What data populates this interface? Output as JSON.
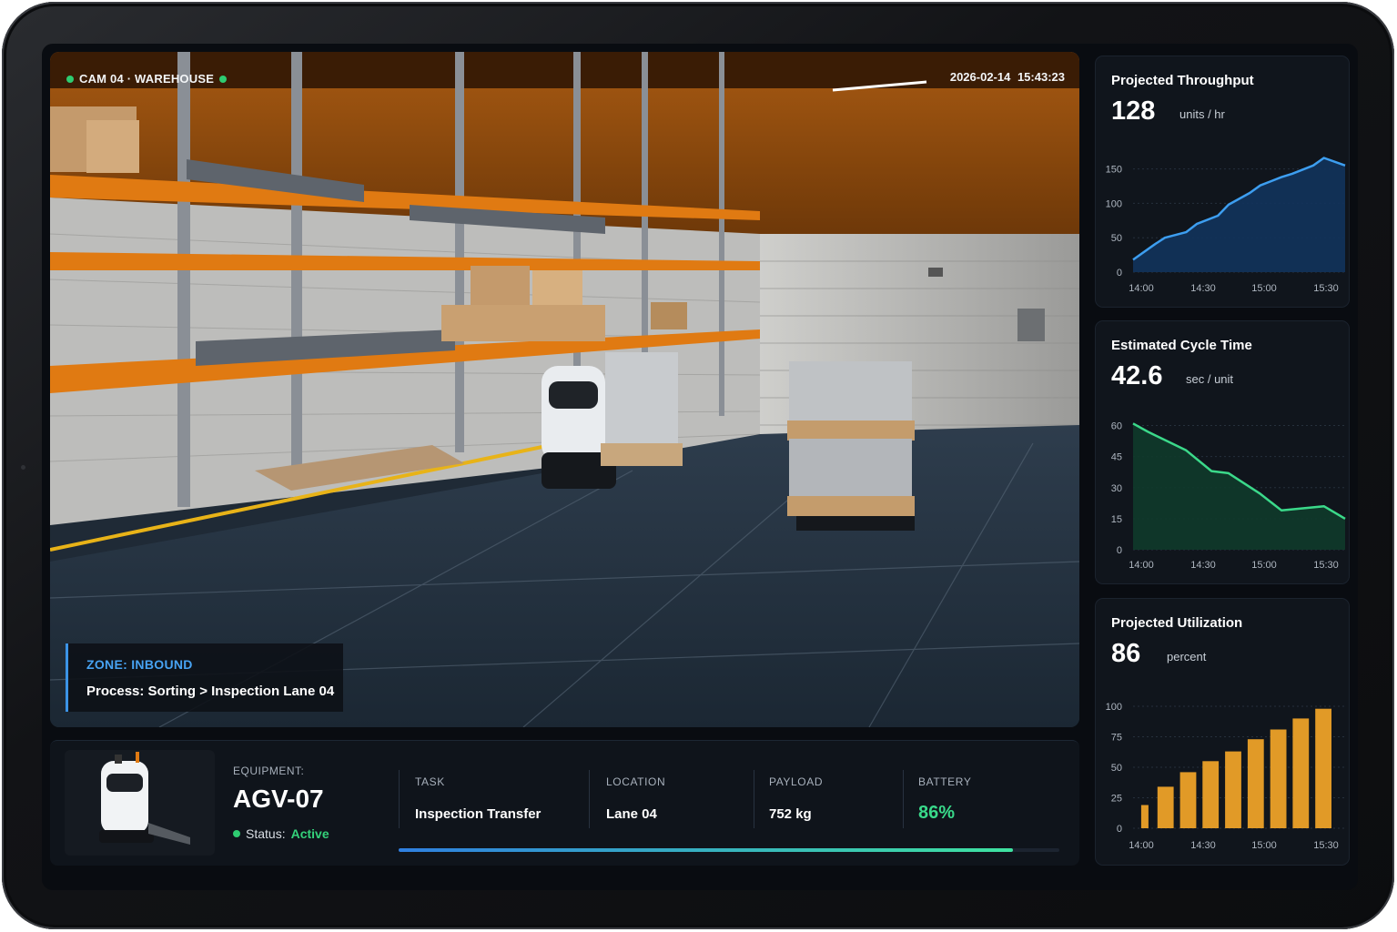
{
  "camera": {
    "label": "CAM 04 · WAREHOUSE",
    "timestamp": "2026-02-14  15:43:23"
  },
  "zone": {
    "title": "ZONE: INBOUND",
    "process": "Process: Sorting > Inspection Lane 04"
  },
  "equipment": {
    "label": "EQUIPMENT:",
    "id": "AGV-07",
    "status_label": "Status:",
    "status_value": "Active",
    "progress": 0.93,
    "columns": [
      {
        "header": "TASK",
        "value": "Inspection Transfer"
      },
      {
        "header": "LOCATION",
        "value": "Lane 04"
      },
      {
        "header": "PAYLOAD",
        "value": "752 kg"
      },
      {
        "header": "BATTERY",
        "value": "86%"
      }
    ]
  },
  "colors": {
    "accent_blue": "#3b93e6",
    "status_green": "#34d27a",
    "throughput_line": "#3d9ef0",
    "cycle_line": "#3bd98a",
    "utilization_bar": "#e19a27"
  },
  "cards": [
    {
      "title": "Projected Throughput",
      "value": "128",
      "unit": "units / hr"
    },
    {
      "title": "Estimated Cycle Time",
      "value": "42.6",
      "unit": "sec / unit"
    },
    {
      "title": "Projected Utilization",
      "value": "86",
      "unit": "percent"
    }
  ],
  "chart_data": [
    {
      "type": "area",
      "title": "Projected Throughput",
      "x_ticks": [
        "14:00",
        "14:30",
        "15:00",
        "15:30"
      ],
      "y_ticks": [
        0,
        50,
        100,
        150
      ],
      "ylim": [
        0,
        160
      ],
      "grid": true,
      "x": [
        "13:55",
        "14:05",
        "14:10",
        "14:20",
        "14:25",
        "14:35",
        "14:40",
        "14:50",
        "14:55",
        "15:05",
        "15:10",
        "15:20",
        "15:25",
        "15:35"
      ],
      "values": [
        18,
        40,
        50,
        58,
        70,
        82,
        98,
        115,
        126,
        138,
        143,
        155,
        166,
        155
      ]
    },
    {
      "type": "area",
      "title": "Estimated Cycle Time",
      "x_ticks": [
        "14:00",
        "14:30",
        "15:00",
        "15:30"
      ],
      "y_ticks": [
        0,
        15,
        30,
        45,
        60
      ],
      "ylim": [
        0,
        62
      ],
      "grid": true,
      "x": [
        "13:55",
        "14:02",
        "14:20",
        "14:32",
        "14:40",
        "14:55",
        "15:05",
        "15:15",
        "15:25",
        "15:35"
      ],
      "values": [
        61,
        57,
        48,
        38,
        37,
        27,
        19,
        20,
        21,
        15
      ]
    },
    {
      "type": "bar",
      "title": "Projected Utilization",
      "x_ticks": [
        "14:00",
        "14:30",
        "15:00",
        "15:30"
      ],
      "y_ticks": [
        0,
        25,
        50,
        75,
        100
      ],
      "ylim": [
        0,
        100
      ],
      "grid": true,
      "values": [
        19,
        34,
        46,
        55,
        63,
        73,
        81,
        90,
        98
      ]
    }
  ]
}
